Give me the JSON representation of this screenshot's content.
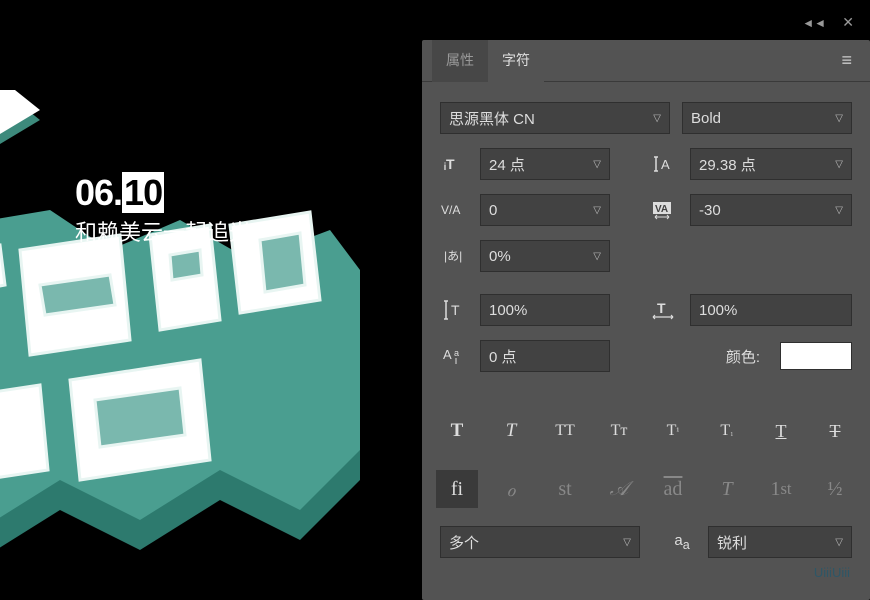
{
  "canvas": {
    "date_prefix": "06.",
    "date_highlight": "10",
    "subtitle": "和赖美云一起追光"
  },
  "panel": {
    "tabs": {
      "properties": "属性",
      "character": "字符"
    },
    "font_family": "思源黑体 CN",
    "font_style": "Bold",
    "font_size": "24 点",
    "leading": "29.38 点",
    "kerning": "0",
    "tracking": "-30",
    "tsume": "0%",
    "vertical_scale": "100%",
    "horizontal_scale": "100%",
    "baseline_shift": "0 点",
    "color_label": "颜色:",
    "language": "多个",
    "antialias": "锐利"
  },
  "watermark": "UiiiUiii"
}
